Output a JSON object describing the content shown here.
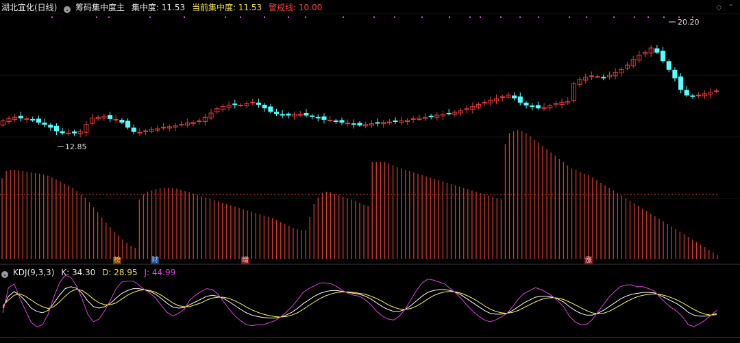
{
  "header": {
    "stock_name": "湖北宜化(日线)",
    "chip_indicator": "筹码集中度主",
    "concentration_label": "集中度:",
    "concentration_value": "11.53",
    "current_concentration_label": "当前集中度:",
    "current_concentration_value": "11.53",
    "warning_label": "警戒线:",
    "warning_value": "10.00"
  },
  "kdj": {
    "name": "KDJ(9,3,3)",
    "k_label": "K:",
    "k_value": "34.30",
    "d_label": "D:",
    "d_value": "28.95",
    "j_label": "J:",
    "j_value": "44.99"
  },
  "markers": {
    "m1": "榜",
    "m2": "财",
    "m3": "增",
    "m4": "涨"
  },
  "colors": {
    "background": "#000000",
    "up_candle": "#e83b3b",
    "down_candle": "#54ffff",
    "concentration_bar": "#d93a2a",
    "k_line": "#ffffff",
    "d_line": "#ffff40",
    "j_line": "#e040e0",
    "warning_line": "#ff3030"
  },
  "chart_data": [
    {
      "type": "candlestick",
      "title": "湖北宜化(日线)",
      "annotations": [
        "12.85",
        "20.20"
      ],
      "ylim": [
        11.0,
        21.2
      ],
      "closes": [
        13.8,
        13.95,
        14.05,
        14.0,
        13.95,
        13.85,
        13.7,
        13.55,
        13.35,
        13.1,
        12.95,
        12.95,
        12.95,
        13.05,
        13.55,
        14.0,
        14.05,
        14.1,
        13.95,
        13.9,
        13.7,
        13.35,
        13.05,
        13.0,
        13.1,
        13.2,
        13.25,
        13.35,
        13.4,
        13.45,
        13.55,
        13.65,
        13.7,
        13.8,
        14.05,
        14.35,
        14.65,
        14.8,
        14.9,
        14.95,
        14.9,
        15.0,
        15.1,
        14.95,
        14.7,
        14.45,
        14.3,
        14.2,
        14.2,
        14.25,
        14.25,
        14.2,
        14.1,
        14.0,
        13.9,
        13.85,
        13.75,
        13.7,
        13.65,
        13.55,
        13.5,
        13.55,
        13.6,
        13.65,
        13.7,
        13.72,
        13.75,
        13.8,
        13.85,
        13.95,
        14.0,
        14.05,
        14.1,
        14.2,
        14.25,
        14.3,
        14.4,
        14.5,
        14.65,
        14.8,
        14.95,
        15.1,
        15.25,
        15.35,
        15.5,
        15.6,
        15.4,
        15.1,
        14.9,
        14.8,
        14.7,
        14.75,
        14.85,
        15.0,
        15.1,
        15.15,
        16.4,
        16.7,
        16.85,
        16.95,
        16.9,
        16.8,
        17.0,
        17.2,
        17.4,
        17.7,
        18.1,
        18.4,
        18.6,
        18.9,
        18.6,
        18.0,
        17.4,
        16.8,
        16.0,
        15.6,
        15.5,
        15.6,
        15.7,
        15.8,
        15.9
      ]
    },
    {
      "type": "bar",
      "title": "筹码集中度主",
      "reference_line": 10.0,
      "ylim": [
        0,
        20.5
      ],
      "values": [
        12.5,
        13.6,
        13.8,
        13.8,
        13.7,
        13.6,
        13.5,
        13.4,
        13.3,
        13.2,
        13.1,
        12.9,
        12.6,
        12.3,
        12.0,
        11.6,
        11.4,
        11.0,
        10.5,
        10.0,
        9.5,
        8.8,
        8.0,
        7.2,
        6.4,
        5.6,
        4.9,
        4.2,
        3.6,
        3.0,
        2.5,
        2.0,
        1.7,
        9.2,
        10.0,
        10.4,
        10.6,
        10.8,
        10.9,
        11.0,
        11.0,
        11.0,
        10.9,
        10.7,
        10.5,
        10.3,
        10.1,
        9.9,
        9.7,
        9.5,
        9.3,
        9.1,
        8.9,
        8.7,
        8.5,
        8.3,
        8.1,
        7.9,
        7.7,
        7.5,
        7.3,
        7.1,
        6.9,
        6.7,
        6.5,
        6.3,
        6.0,
        5.7,
        5.4,
        5.1,
        4.8,
        4.6,
        4.4,
        4.4,
        6.5,
        8.5,
        9.5,
        10.2,
        10.4,
        10.3,
        10.1,
        9.9,
        9.6,
        9.4,
        9.2,
        9.0,
        8.7,
        8.4,
        8.2,
        15.0,
        15.0,
        15.0,
        15.0,
        14.8,
        14.5,
        14.2,
        14.0,
        13.8,
        13.6,
        13.4,
        13.2,
        13.0,
        12.8,
        12.6,
        12.4,
        12.2,
        12.0,
        11.8,
        11.6,
        11.4,
        11.2,
        11.0,
        10.8,
        10.6,
        10.4,
        10.2,
        10.0,
        9.8,
        9.6,
        9.4,
        9.2,
        17.8,
        19.5,
        19.8,
        20.0,
        19.8,
        19.5,
        19.0,
        18.5,
        18.0,
        17.5,
        17.0,
        16.5,
        16.0,
        15.5,
        15.0,
        14.5,
        14.0,
        13.8,
        13.5,
        13.2,
        13.0,
        12.6,
        12.2,
        11.8,
        11.4,
        11.0,
        10.6,
        10.2,
        9.8,
        9.4,
        9.0,
        8.6,
        8.2,
        7.8,
        7.4,
        7.0,
        6.6,
        6.2,
        5.8,
        5.4,
        5.0,
        4.6,
        4.2,
        3.8,
        3.4,
        3.0,
        2.6,
        2.2,
        1.8,
        1.4,
        1.0,
        0.6
      ]
    },
    {
      "type": "line",
      "title": "KDJ(9,3,3)",
      "ylim": [
        -10,
        110
      ],
      "series": [
        {
          "name": "K",
          "values": [
            45,
            70,
            80,
            72,
            60,
            45,
            38,
            35,
            40,
            55,
            72,
            86,
            90,
            87,
            76,
            60,
            48,
            45,
            48,
            55,
            66,
            76,
            82,
            86,
            86,
            84,
            80,
            74,
            65,
            55,
            47,
            45,
            46,
            52,
            58,
            64,
            70,
            72,
            70,
            65,
            58,
            50,
            42,
            35,
            30,
            27,
            25,
            24,
            24,
            26,
            30,
            36,
            44,
            54,
            62,
            70,
            76,
            80,
            82,
            82,
            80,
            78,
            76,
            74,
            70,
            64,
            56,
            48,
            42,
            38,
            38,
            42,
            50,
            60,
            70,
            78,
            82,
            84,
            84,
            82,
            78,
            72,
            64,
            56,
            48,
            40,
            34,
            32,
            32,
            34,
            40,
            48,
            56,
            62,
            68,
            70,
            70,
            68,
            64,
            58,
            48,
            40,
            34,
            30,
            30,
            34,
            40,
            48,
            56,
            64,
            70,
            74,
            76,
            78,
            78,
            77,
            72,
            66,
            60,
            54,
            46,
            36,
            30,
            28,
            28,
            30,
            34
          ]
        },
        {
          "name": "D",
          "values": [
            50,
            62,
            72,
            75,
            70,
            62,
            54,
            48,
            44,
            48,
            58,
            70,
            80,
            85,
            82,
            74,
            64,
            56,
            52,
            52,
            56,
            64,
            72,
            78,
            82,
            84,
            82,
            78,
            72,
            64,
            56,
            50,
            48,
            48,
            52,
            56,
            62,
            66,
            68,
            68,
            65,
            60,
            54,
            47,
            41,
            36,
            32,
            29,
            27,
            26,
            27,
            30,
            35,
            42,
            50,
            58,
            65,
            71,
            75,
            78,
            79,
            79,
            78,
            76,
            74,
            70,
            65,
            59,
            52,
            47,
            43,
            42,
            44,
            49,
            56,
            64,
            71,
            76,
            79,
            80,
            79,
            76,
            71,
            65,
            58,
            50,
            43,
            38,
            35,
            34,
            36,
            40,
            46,
            52,
            58,
            63,
            66,
            67,
            66,
            63,
            58,
            52,
            46,
            40,
            35,
            33,
            34,
            38,
            44,
            51,
            58,
            64,
            69,
            72,
            74,
            75,
            74,
            71,
            67,
            62,
            56,
            49,
            42,
            36,
            32,
            30,
            31
          ]
        },
        {
          "name": "J",
          "values": [
            35,
            88,
            96,
            66,
            40,
            15,
            5,
            10,
            32,
            68,
            98,
            114,
            110,
            92,
            64,
            32,
            16,
            22,
            40,
            62,
            86,
            100,
            102,
            102,
            94,
            84,
            76,
            66,
            50,
            36,
            28,
            34,
            42,
            62,
            72,
            80,
            86,
            84,
            74,
            58,
            42,
            28,
            18,
            10,
            8,
            10,
            10,
            14,
            18,
            26,
            36,
            48,
            62,
            78,
            86,
            92,
            98,
            98,
            96,
            90,
            82,
            76,
            72,
            70,
            62,
            52,
            38,
            28,
            22,
            20,
            28,
            42,
            62,
            82,
            98,
            106,
            104,
            100,
            96,
            86,
            76,
            64,
            50,
            38,
            28,
            20,
            16,
            20,
            26,
            34,
            48,
            64,
            76,
            82,
            88,
            84,
            78,
            70,
            60,
            48,
            28,
            16,
            10,
            10,
            20,
            36,
            52,
            68,
            80,
            90,
            94,
            94,
            90,
            90,
            86,
            81,
            68,
            56,
            46,
            38,
            26,
            10,
            6,
            12,
            20,
            30,
            40
          ]
        }
      ]
    }
  ]
}
